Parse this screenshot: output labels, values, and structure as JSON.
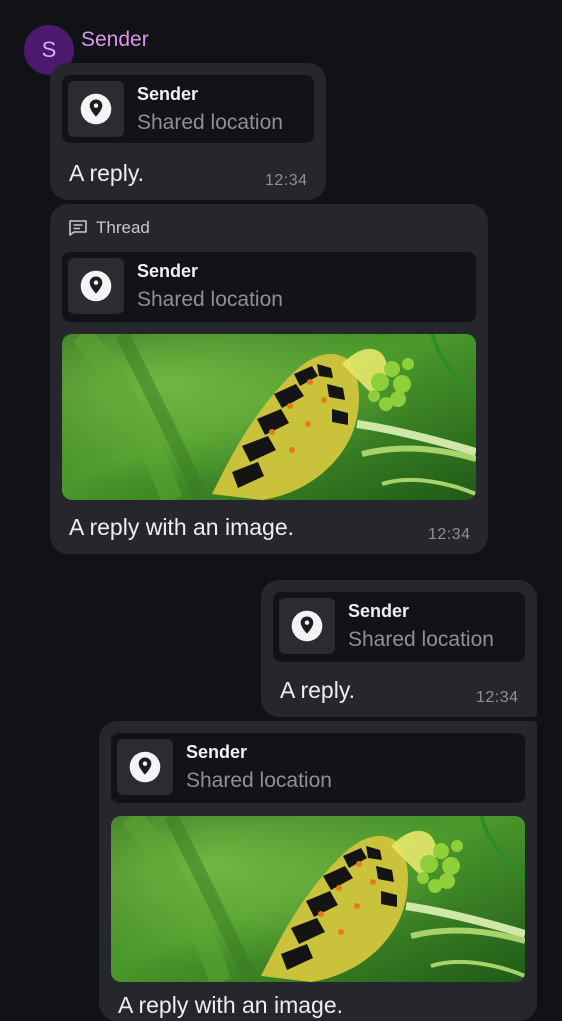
{
  "sender": {
    "initial": "S",
    "name": "Sender"
  },
  "colors": {
    "background": "#101216",
    "bubble": "#25272c",
    "quote_bg": "#111317",
    "avatar_bg": "#4b1a6e",
    "sender_name": "#d996ec",
    "muted_text": "#8e9096"
  },
  "messages": [
    {
      "quote": {
        "sender": "Sender",
        "text": "Shared location",
        "icon": "location-pin-icon"
      },
      "text": "A reply.",
      "time": "12:34"
    },
    {
      "thread_label": "Thread",
      "thread_icon": "thread-icon",
      "quote": {
        "sender": "Sender",
        "text": "Shared location",
        "icon": "location-pin-icon"
      },
      "image": "caterpillar-photo",
      "text": "A reply with an image.",
      "time": "12:34"
    },
    {
      "quote": {
        "sender": "Sender",
        "text": "Shared location",
        "icon": "location-pin-icon"
      },
      "text": "A reply.",
      "time": "12:34"
    },
    {
      "quote": {
        "sender": "Sender",
        "text": "Shared location",
        "icon": "location-pin-icon"
      },
      "image": "caterpillar-photo",
      "text": "A reply with an image."
    }
  ]
}
